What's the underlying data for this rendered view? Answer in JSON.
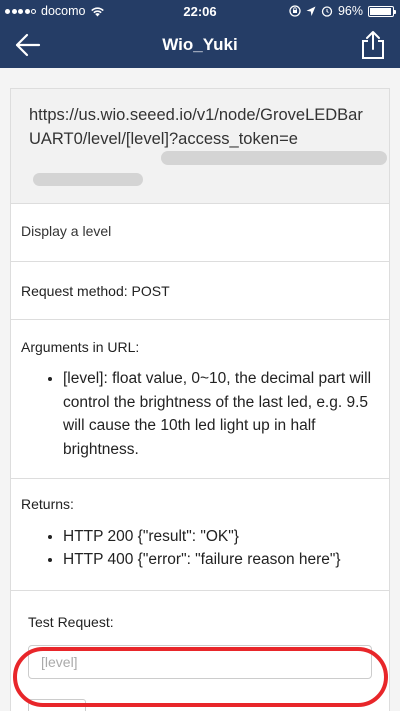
{
  "status_bar": {
    "carrier": "docomo",
    "time": "22:06",
    "battery_percent": "96%",
    "battery_level": 0.96
  },
  "nav": {
    "title": "Wio_Yuki"
  },
  "endpoint": {
    "url": "https://us.wio.seeed.io/v1/node/GroveLEDBarUART0/level/[level]?access_token=",
    "token_prefix": "e"
  },
  "description": "Display a level",
  "method": {
    "label": "Request method:",
    "value": "POST"
  },
  "arguments": {
    "title": "Arguments in URL:",
    "items": [
      "[level]: float value, 0~10, the decimal part will control the brightness of the last led, e.g. 9.5 will cause the 10th led light up in half brightness."
    ]
  },
  "returns": {
    "title": "Returns:",
    "items": [
      "HTTP 200 {\"result\": \"OK\"}",
      "HTTP 400 {\"error\": \"failure reason here\"}"
    ]
  },
  "test_request": {
    "title": "Test Request:",
    "input_placeholder": "[level]"
  },
  "colors": {
    "nav_bg": "#253d66",
    "highlight": "#e8262a"
  }
}
